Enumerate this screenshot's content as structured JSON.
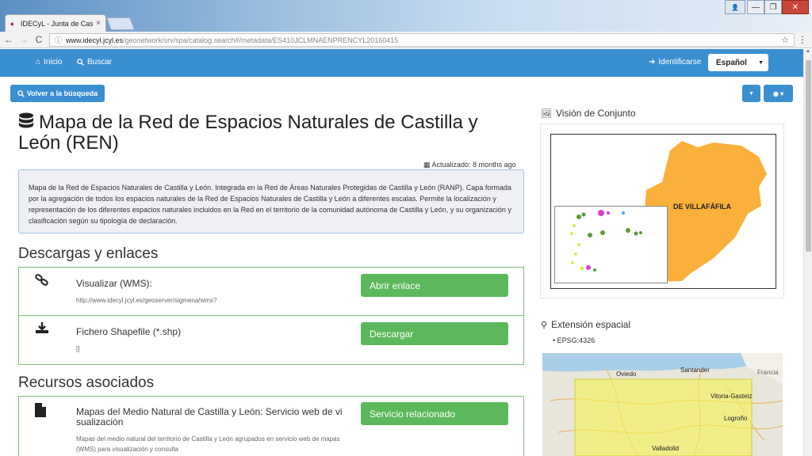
{
  "browser": {
    "tab_title": "IDECyL - Junta de Castill",
    "tab_close": "×",
    "url_host": "www.idecyl.jcyl.es",
    "url_path": "/geonetwork/srv/spa/catalog.search#/metadata/ES410JCLMNAENPRENCYL20160415",
    "back": "←",
    "forward": "→",
    "reload": "C",
    "win_min": "—",
    "win_max": "❐",
    "win_close": "✕"
  },
  "navbar": {
    "home": "Inicio",
    "search": "Buscar",
    "login": "Identificarse",
    "language": "Español"
  },
  "toolbar": {
    "back_to_search": "Volver a la búsqueda"
  },
  "record": {
    "title": "Mapa de la Red de Espacios Naturales de Castilla y León (REN)",
    "updated": "Actualizado: 8 months ago",
    "abstract": "Mapa de la Red de Espacios Naturales de Castilla y León. Integrada en la Red de Áreas Naturales Protegidas de Castilla y León (RANP). Capa formada por la agregación de todos los espacios naturales de la Red de Espacios Naturales de Castilla y León a diferentes escalas. Permite la localización y representación de los diferentes espacios naturales incluidos en la Red en el territorio de la comunidad autónoma de Castilla y León, y su organización y clasificación según su tipología de declaración."
  },
  "downloads": {
    "heading": "Descargas y enlaces",
    "items": [
      {
        "title": "Visualizar (WMS):",
        "sub": "http://www.idecyl.jcyl.es/geoserver/sigmena/wms?",
        "button": "Abrir enlace",
        "icon": "link-icon"
      },
      {
        "title": "Fichero Shapefile (*.shp)",
        "sub": "[]",
        "button": "Descargar",
        "icon": "download-icon"
      }
    ]
  },
  "resources": {
    "heading": "Recursos asociados",
    "items": [
      {
        "title": "Mapas del Medio Natural de Castilla y León: Servicio web de vi sualización",
        "sub": "Mapas del medio natural del territorio de Castilla y León agrupados en servicio web de mapas (WMS) para visualización y consulta",
        "button": "Servicio relacionado",
        "icon": "file-icon"
      }
    ]
  },
  "sidebar": {
    "overview_heading": "Visión de Conjunto",
    "overview_label": "DE VILLAFÁFILA",
    "extent_heading": "Extensión espacial",
    "epsg": "EPSG:4326",
    "map_labels": [
      "Oviedo",
      "Santander",
      "Francia",
      "Vitoria-Gasteiz",
      "Logroño",
      "Valladolid"
    ]
  },
  "colors": {
    "navbar": "#3a8fd0",
    "success": "#5cb85c",
    "overview_fill": "#fbb03b"
  }
}
